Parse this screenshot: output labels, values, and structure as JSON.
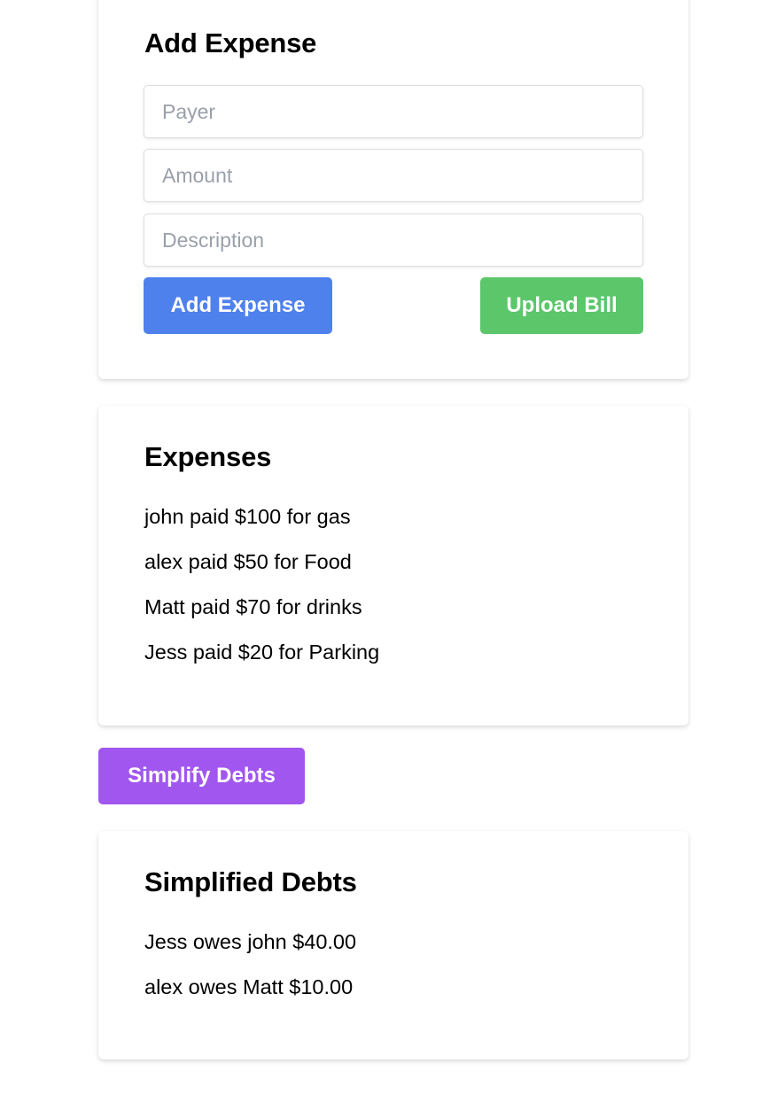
{
  "add_expense": {
    "title": "Add Expense",
    "payer_placeholder": "Payer",
    "amount_placeholder": "Amount",
    "description_placeholder": "Description",
    "add_button_label": "Add Expense",
    "upload_button_label": "Upload Bill"
  },
  "expenses": {
    "title": "Expenses",
    "items": [
      "john paid $100 for gas",
      "alex paid $50 for Food",
      "Matt paid $70 for drinks",
      "Jess paid $20 for Parking"
    ]
  },
  "simplify_button_label": "Simplify Debts",
  "simplified_debts": {
    "title": "Simplified Debts",
    "items": [
      "Jess owes john $40.00",
      "alex owes Matt $10.00"
    ]
  },
  "colors": {
    "add_button": "#4f81ed",
    "upload_button": "#5cc66b",
    "simplify_button": "#a156ef"
  }
}
